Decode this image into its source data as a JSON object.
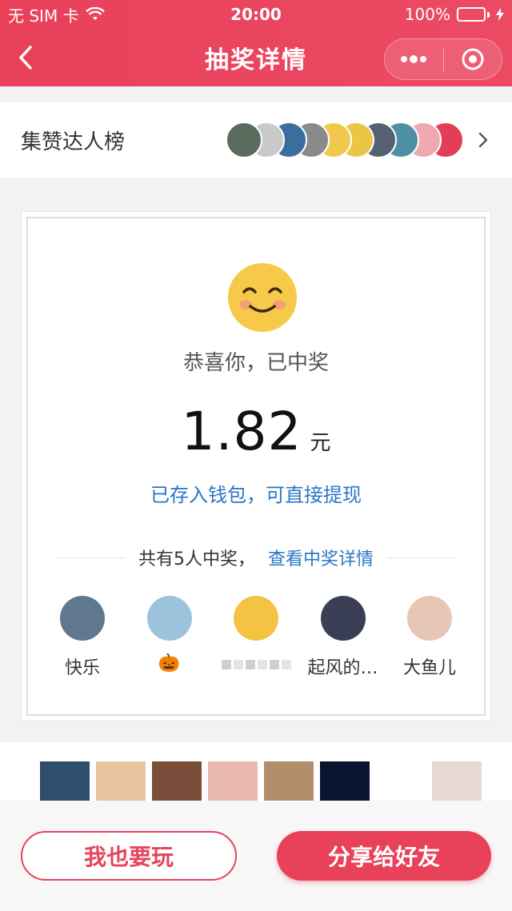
{
  "status_bar": {
    "carrier": "无 SIM 卡",
    "time": "20:00",
    "battery": "100%"
  },
  "nav": {
    "title": "抽奖详情"
  },
  "leaderboard": {
    "title": "集赞达人榜",
    "avatar_colors": [
      "#5b6b5e",
      "#c9c9c9",
      "#3b6e9e",
      "#8a8a8a",
      "#f2c94c",
      "#e9c646",
      "#556070",
      "#4f8fa3",
      "#f0a8b2",
      "#e23e58"
    ]
  },
  "result": {
    "congrats": "恭喜你，已中奖",
    "amount": "1.82",
    "unit": "元",
    "wallet_note": "已存入钱包，可直接提现",
    "winners_count": "共有5人中奖，",
    "winners_link": "查看中奖详情"
  },
  "winners": [
    {
      "name": "快乐",
      "avatar_color": "#5f7890"
    },
    {
      "name": "🎃",
      "avatar_color": "#9cc3dc"
    },
    {
      "name": "",
      "avatar_color": "#f4c343"
    },
    {
      "name": "起风的…",
      "avatar_color": "#3b3f55"
    },
    {
      "name": "大鱼儿",
      "avatar_color": "#e7c6b6"
    }
  ],
  "thumb_colors": [
    "#2f4d6e",
    "#e8c4a0",
    "#7a4d3a",
    "#e9b8b0",
    "#b38e6a",
    "#0a1430",
    "#ffffff",
    "#e6d8d4"
  ],
  "actions": {
    "play_label": "我也要玩",
    "share_label": "分享给好友"
  },
  "colors": {
    "brand": "#e9405a",
    "link": "#2a76c6"
  }
}
